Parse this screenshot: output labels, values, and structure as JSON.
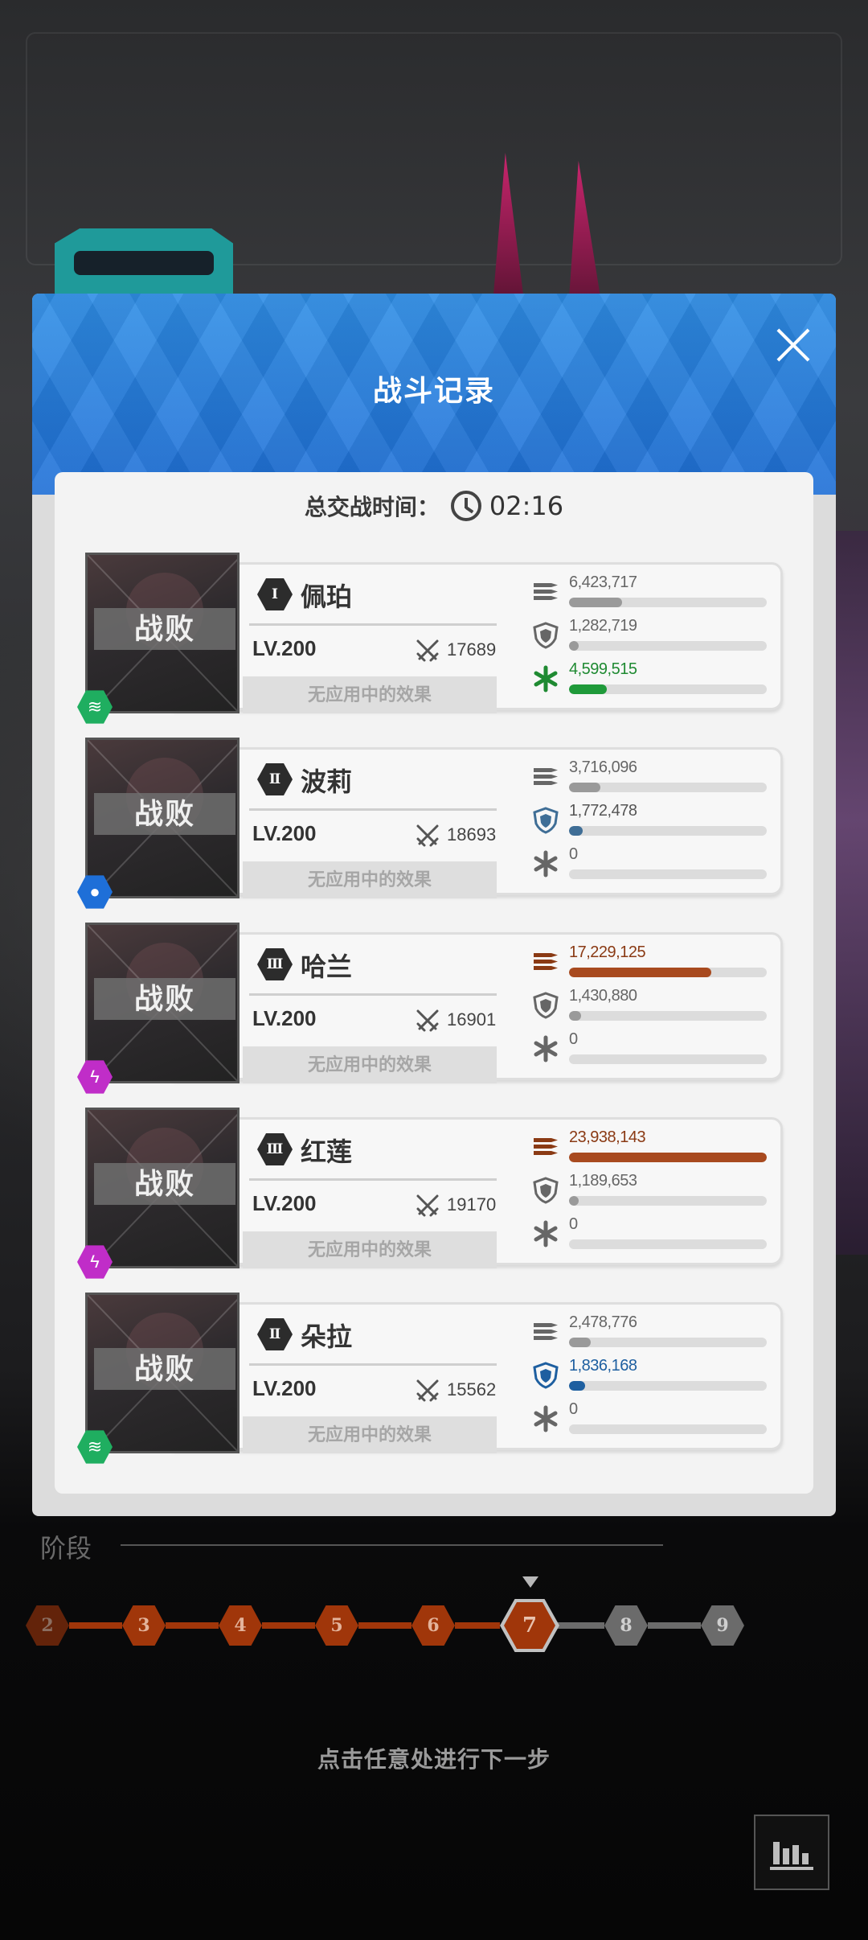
{
  "modal": {
    "title": "战斗记录",
    "total_time_label": "总交战时间：",
    "total_time_value": "02:16"
  },
  "rows": [
    {
      "rank": "Ⅰ",
      "name": "佩珀",
      "level": "LV.200",
      "power": "17689",
      "status": "战败",
      "effects": "无应用中的效果",
      "element": "wind-icon",
      "stats": [
        {
          "kind": "damage",
          "value": "6,423,717",
          "fraction": 0.27,
          "color": "#9a9a9a",
          "text_color": "#666666"
        },
        {
          "kind": "damage_taken",
          "value": "1,282,719",
          "fraction": 0.05,
          "color": "#9a9a9a",
          "text_color": "#666666"
        },
        {
          "kind": "healing",
          "value": "4,599,515",
          "fraction": 0.19,
          "color": "#1f9a3a",
          "text_color": "#1f8a32"
        }
      ]
    },
    {
      "rank": "Ⅱ",
      "name": "波莉",
      "level": "LV.200",
      "power": "18693",
      "status": "战败",
      "effects": "无应用中的效果",
      "element": "water-icon",
      "stats": [
        {
          "kind": "damage",
          "value": "3,716,096",
          "fraction": 0.16,
          "color": "#9a9a9a",
          "text_color": "#666666"
        },
        {
          "kind": "damage_taken",
          "value": "1,772,478",
          "fraction": 0.07,
          "color": "#3f6e96",
          "text_color": "#555555"
        },
        {
          "kind": "healing",
          "value": "0",
          "fraction": 0.0,
          "color": "#9a9a9a",
          "text_color": "#666666"
        }
      ]
    },
    {
      "rank": "Ⅲ",
      "name": "哈兰",
      "level": "LV.200",
      "power": "16901",
      "status": "战败",
      "effects": "无应用中的效果",
      "element": "electric-icon",
      "stats": [
        {
          "kind": "damage",
          "value": "17,229,125",
          "fraction": 0.72,
          "color": "#a84a1f",
          "text_color": "#8a3a14"
        },
        {
          "kind": "damage_taken",
          "value": "1,430,880",
          "fraction": 0.06,
          "color": "#9a9a9a",
          "text_color": "#666666"
        },
        {
          "kind": "healing",
          "value": "0",
          "fraction": 0.0,
          "color": "#9a9a9a",
          "text_color": "#666666"
        }
      ]
    },
    {
      "rank": "Ⅲ",
      "name": "红莲",
      "level": "LV.200",
      "power": "19170",
      "status": "战败",
      "effects": "无应用中的效果",
      "element": "electric-icon",
      "stats": [
        {
          "kind": "damage",
          "value": "23,938,143",
          "fraction": 1.0,
          "color": "#a84a1f",
          "text_color": "#8a3a14"
        },
        {
          "kind": "damage_taken",
          "value": "1,189,653",
          "fraction": 0.05,
          "color": "#9a9a9a",
          "text_color": "#666666"
        },
        {
          "kind": "healing",
          "value": "0",
          "fraction": 0.0,
          "color": "#9a9a9a",
          "text_color": "#666666"
        }
      ]
    },
    {
      "rank": "Ⅱ",
      "name": "朵拉",
      "level": "LV.200",
      "power": "15562",
      "status": "战败",
      "effects": "无应用中的效果",
      "element": "wind-icon",
      "stats": [
        {
          "kind": "damage",
          "value": "2,478,776",
          "fraction": 0.11,
          "color": "#9a9a9a",
          "text_color": "#666666"
        },
        {
          "kind": "damage_taken",
          "value": "1,836,168",
          "fraction": 0.08,
          "color": "#1e5fa0",
          "text_color": "#1e5fa0"
        },
        {
          "kind": "healing",
          "value": "0",
          "fraction": 0.0,
          "color": "#9a9a9a",
          "text_color": "#666666"
        }
      ]
    }
  ],
  "stage": {
    "label": "阶段",
    "nodes": [
      "2",
      "3",
      "4",
      "5",
      "6",
      "7",
      "8",
      "9"
    ],
    "current": "7",
    "completed_color": "#a0360a",
    "future_color": "#6b6b6b"
  },
  "footer": {
    "hint": "点击任意处进行下一步"
  }
}
